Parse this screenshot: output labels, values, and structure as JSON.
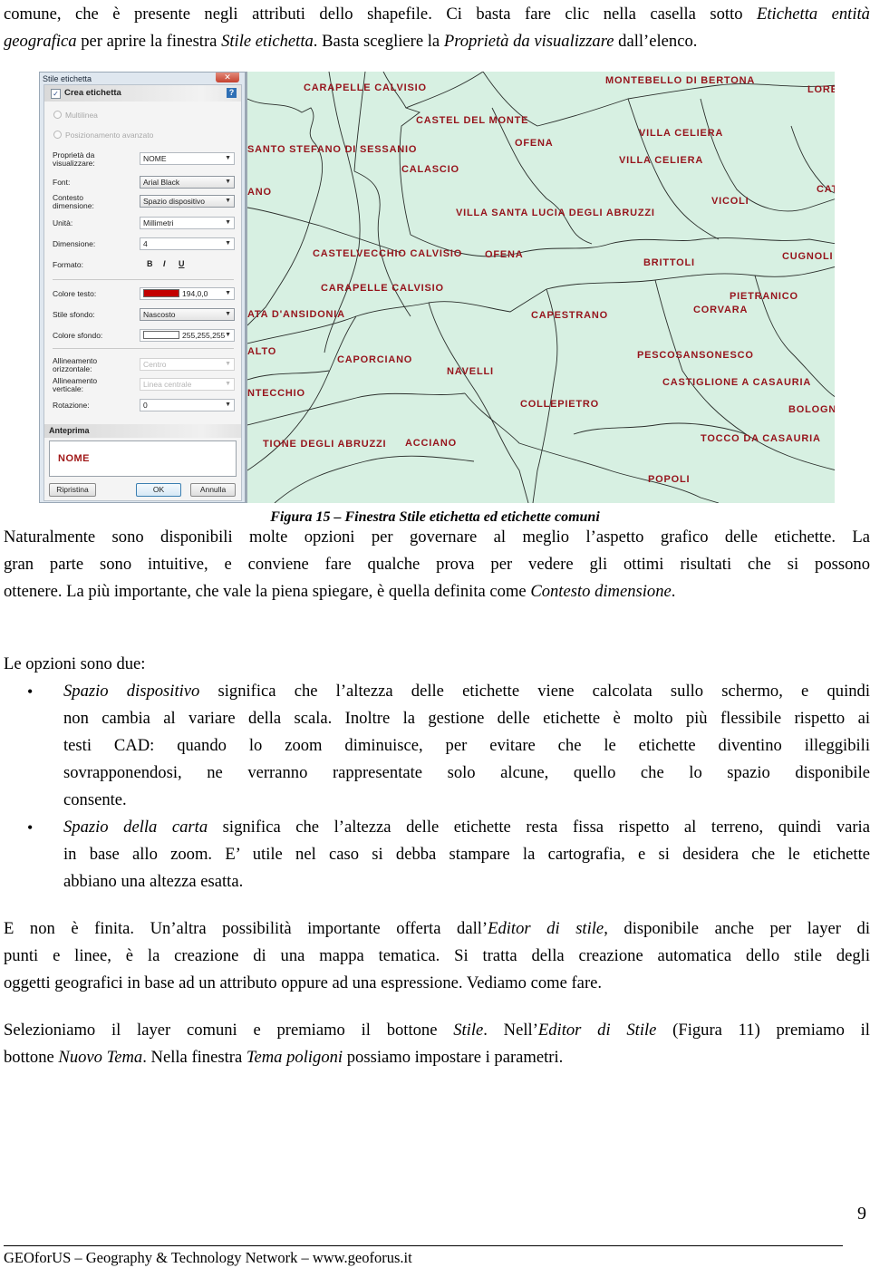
{
  "intro": {
    "line1_plain": "comune, che è presente negli attributi dello shapefile. Ci basta fare clic nella casella sotto ",
    "line1_italic": "Etichetta entità",
    "line2_italic_a": "geografica",
    "line2_plain_a": " per aprire la finestra ",
    "line2_italic_b": "Stile etichetta",
    "line2_plain_b": ". Basta scegliere la ",
    "line2_italic_c": "Proprietà da visualizzare",
    "line2_plain_c": " dall’elenco."
  },
  "dialog": {
    "title": "Stile etichetta",
    "close_glyph": "✕",
    "create_label": "Crea etichetta",
    "create_checked": true,
    "help_glyph": "?",
    "radio_multiline": "Multilinea",
    "radio_advanced": "Posizionamento avanzato",
    "fields": {
      "property_label": "Proprietà da visualizzare:",
      "property_value": "NOME",
      "font_label": "Font:",
      "font_value": "Arial Black",
      "context_label": "Contesto dimensione:",
      "context_value": "Spazio dispositivo",
      "unit_label": "Unità:",
      "unit_value": "Millimetri",
      "size_label": "Dimensione:",
      "size_value": "4",
      "format_label": "Formato:",
      "format_bold": "B",
      "format_italic": "I",
      "format_underline": "U",
      "text_color_label": "Colore testo:",
      "text_color_value": "194,0,0",
      "text_color_hex": "#c20000",
      "bg_style_label": "Stile sfondo:",
      "bg_style_value": "Nascosto",
      "bg_color_label": "Colore sfondo:",
      "bg_color_value": "255,255,255",
      "bg_color_hex": "#ffffff",
      "h_align_label": "Allineamento orizzontale:",
      "h_align_value": "Centro",
      "v_align_label": "Allineamento verticale:",
      "v_align_value": "Linea centrale",
      "rotation_label": "Rotazione:",
      "rotation_value": "0"
    },
    "preview_header": "Anteprima",
    "preview_text": "NOME",
    "buttons": {
      "reset": "Ripristina",
      "ok": "OK",
      "cancel": "Annulla"
    }
  },
  "map": {
    "label_color": "#96141c",
    "background": "#d7f0e2",
    "towns": [
      "CARAPELLE CALVISIO",
      "MONTEBELLO DI BERTONA",
      "LORE",
      "CASTEL DEL MONTE",
      "SANTO STEFANO DI SESSANIO",
      "OFENA",
      "VILLA CELIERA",
      "VILLA CELIERA",
      "CALASCIO",
      "ANO",
      "CAT",
      "VICOLI",
      "VILLA SANTA LUCIA DEGLI ABRUZZI",
      "CASTELVECCHIO CALVISIO",
      "OFENA",
      "CUGNOLI",
      "BRITTOLI",
      "CARAPELLE CALVISIO",
      "PIETRANICO",
      "ATA D'ANSIDONIA",
      "CAPESTRANO",
      "CORVARA",
      "ALTO",
      "PESCOSANSONESCO",
      "CAPORCIANO",
      "NAVELLI",
      "CASTIGLIONE A CASAURIA",
      "NTECCHIO",
      "BOLOGN",
      "COLLEPIETRO",
      "TOCCO DA CASAURIA",
      "TIONE DEGLI ABRUZZI",
      "ACCIANO",
      "POPOLI"
    ]
  },
  "caption": "Figura 15 – Finestra Stile etichetta ed etichette comuni",
  "para1": {
    "line1": "Naturalmente sono disponibili molte opzioni per governare al meglio l’aspetto grafico delle etichette. La",
    "line2": "gran parte sono intuitive, e conviene fare qualche prova per vedere gli ottimi risultati che si possono",
    "line3_plain": "ottenere. La più importante, che vale la piena spiegare, è quella definita come ",
    "line3_italic": "Contesto dimensione",
    "line3_end": "."
  },
  "options_intro": "Le opzioni sono due:",
  "bullet_glyph": "•",
  "bullet1": {
    "italic": "Spazio dispositivo",
    "line1_rest": " significa che l’altezza delle etichette viene calcolata sullo schermo, e quindi",
    "line2": "non cambia al variare della scala. Inoltre la gestione delle etichette è molto più flessibile rispetto ai",
    "line3": "testi CAD: quando lo zoom diminuisce, per evitare che le etichette diventino illeggibili",
    "line4": "sovrapponendosi, ne verranno rappresentate solo alcune, quello che lo spazio disponibile",
    "line5": "consente."
  },
  "bullet2": {
    "italic": "Spazio della carta",
    "line1_rest": " significa che l’altezza delle etichette resta fissa rispetto al terreno, quindi varia",
    "line2": "in base allo zoom. E’ utile nel caso si debba stampare la cartografia, e si desidera che le etichette",
    "line3": "abbiano una altezza esatta."
  },
  "para2": {
    "line1_plain": "E non è finita. Un’altra possibilità importante offerta dall’",
    "line1_italic": "Editor di stile",
    "line1_end": ", disponibile anche per layer di",
    "line2": "punti e linee, è la creazione di una mappa tematica. Si tratta della creazione automatica dello stile degli",
    "line3": "oggetti geografici in base ad un attributo oppure ad una espressione. Vediamo come fare."
  },
  "para3": {
    "line1_a": "Selezioniamo il layer comuni e premiamo il bottone ",
    "line1_i1": "Stile",
    "line1_b": ". Nell’",
    "line1_i2": "Editor di Stile",
    "line1_c": " (Figura 11) premiamo il",
    "line2_a": "bottone ",
    "line2_i1": "Nuovo Tema",
    "line2_b": ". Nella finestra ",
    "line2_i2": "Tema poligoni",
    "line2_c": " possiamo impostare i parametri."
  },
  "page_number": "9",
  "footer": "GEOforUS – Geography & Technology Network – www.geoforus.it"
}
